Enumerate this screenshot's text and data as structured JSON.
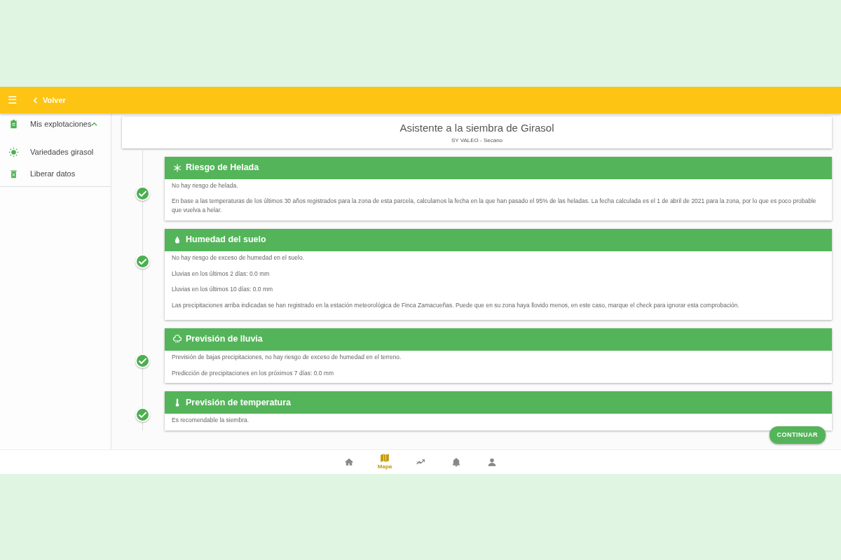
{
  "topbar": {
    "menu": "☰",
    "back": "Volver"
  },
  "sidebar": {
    "items": [
      {
        "kind": "clipboard",
        "label": "Mis explotaciones",
        "expanded": true
      },
      {
        "kind": "sun",
        "label": "Variedades girasol"
      },
      {
        "kind": "trash",
        "label": "Liberar datos"
      }
    ]
  },
  "header": {
    "title": "Asistente a la siembra de Girasol",
    "subtitle": "SY VALEO - Secano"
  },
  "steps": [
    {
      "kind": "frost",
      "title": "Riesgo de Helada",
      "done": true,
      "paragraphs": [
        "No hay riesgo de helada.",
        "En base a las temperaturas de los últimos 30 años registrados para la zona de esta parcela, calculamos la fecha en la que han pasado el 95% de las heladas. La fecha calculada es el 1 de abril de 2021 para la zona, por lo que es poco probable que vuelva a helar."
      ]
    },
    {
      "kind": "drop",
      "title": "Humedad del suelo",
      "done": true,
      "paragraphs": [
        "No hay riesgo de exceso de humedad en el suelo.",
        "Lluvias en los últimos 2 días: 0.0 mm",
        "Lluvias en los últimos 10 días: 0.0 mm",
        "Las precipitaciones arriba indicadas se han registrado en la estación meteorológica de Finca Zamacueñas. Puede que en su zona haya llovido menos, en este caso, marque el check para ignorar esta comprobación."
      ]
    },
    {
      "kind": "rain",
      "title": "Previsión de lluvia",
      "done": true,
      "paragraphs": [
        "Previsión de bajas precipitaciones, no hay riesgo de exceso de humedad en el terreno.",
        "Predicción de precipitaciones en los próximos 7 días: 0.0 mm"
      ]
    },
    {
      "kind": "thermometer",
      "title": "Previsión de temperatura",
      "done": true,
      "paragraphs": [
        "Es recomendable la siembra."
      ]
    }
  ],
  "continue_button": "CONTINUAR",
  "bottom_nav": [
    {
      "kind": "home",
      "selected": false
    },
    {
      "kind": "map",
      "label": "Mapa",
      "selected": true
    },
    {
      "kind": "trend",
      "selected": false
    },
    {
      "kind": "bell",
      "selected": false
    },
    {
      "kind": "person",
      "selected": false
    }
  ]
}
